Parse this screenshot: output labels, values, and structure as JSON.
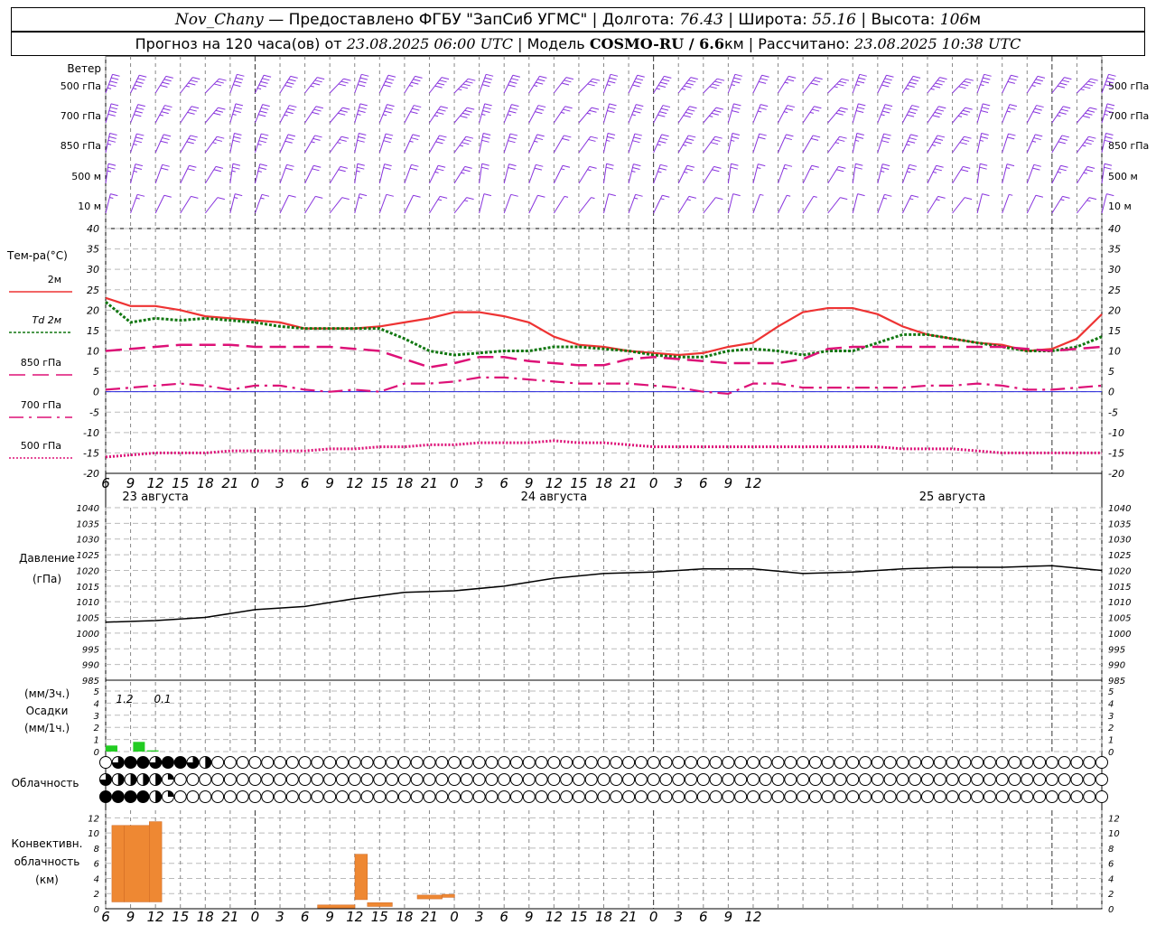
{
  "header": {
    "station": "Nov_Chany",
    "provider": "— Предоставлено ФГБУ \"ЗапСиб УГМС\"",
    "lon_label": "Долгота:",
    "lon_value": "76.43",
    "lat_label": "Широта:",
    "lat_value": "55.16",
    "alt_label": "Высота:",
    "alt_value": "106",
    "alt_unit": "м",
    "forecast_label": "Прогноз на 120 часа(ов) от",
    "forecast_start": "23.08.2025 06:00 UTC",
    "model_label": "Модель",
    "model_name": "COSMO-RU / 6.6",
    "model_unit": "км",
    "calc_label": "Рассчитано:",
    "calc_time": "23.08.2025 10:38 UTC"
  },
  "labels": {
    "wind": "Ветер",
    "wind_levels": [
      "500 гПа",
      "700 гПа",
      "850 гПа",
      "500 м",
      "10 м"
    ],
    "temp_title": "Тем-ра(°C)",
    "temp_legend": [
      "2м",
      "Td 2м",
      "850 гПа",
      "700 гПа",
      "500 гПа"
    ],
    "pressure_title": "Давление",
    "pressure_unit": "(гПа)",
    "precip_unit_3h": "(мм/3ч.)",
    "precip_title": "Осадки",
    "precip_unit_1h": "(мм/1ч.)",
    "precip_values": [
      "1.2",
      "0.1"
    ],
    "cloud_title": "Облачность",
    "conv_title_1": "Конвективн.",
    "conv_title_2": "облачность",
    "conv_unit": "(км)",
    "days": [
      "23 августа",
      "24 августа",
      "25 августа"
    ]
  },
  "colors": {
    "t2m": "#ee3333",
    "td2m": "#117711",
    "t850": "#dd1177",
    "t700": "#dd1177",
    "t500": "#dd1177",
    "wind": "#8833dd",
    "precip": "#22cc22",
    "conv": "#ee8833",
    "zero_line": "#2222dd"
  },
  "chart_data": [
    {
      "type": "line",
      "title": "Тем-ра(°C)",
      "x_unit": "hours from 23.08.2025 06:00 UTC",
      "x_tick_labels": [
        "6",
        "9",
        "12",
        "15",
        "18",
        "21",
        "0",
        "3",
        "6",
        "9",
        "12",
        "15",
        "18",
        "21",
        "0",
        "3",
        "6",
        "9",
        "12",
        "15",
        "18",
        "21",
        "0",
        "3",
        "6",
        "9",
        "12"
      ],
      "ylim": [
        -20,
        40
      ],
      "series": [
        {
          "name": "2м",
          "x": [
            0,
            3,
            6,
            9,
            12,
            15,
            18,
            21,
            24,
            27,
            30,
            33,
            36,
            39,
            42,
            45,
            48,
            51,
            54,
            57,
            60,
            63,
            66,
            69,
            72,
            75,
            78,
            81,
            84,
            87,
            90,
            93,
            96,
            99,
            102,
            105,
            108,
            111,
            114,
            117,
            120
          ],
          "values": [
            23,
            21,
            21,
            20,
            18.5,
            18,
            17.5,
            17,
            15.5,
            15.5,
            15.5,
            16,
            17,
            18,
            19.5,
            19.5,
            18.5,
            17,
            13.5,
            11.5,
            11,
            10,
            9.5,
            9,
            9.5,
            11,
            12,
            16,
            19.5,
            20.5,
            20.5,
            19,
            16,
            14,
            13,
            12,
            11.5,
            10,
            10.5,
            13,
            19
          ]
        },
        {
          "name": "Td 2м",
          "x": [
            0,
            3,
            6,
            9,
            12,
            15,
            18,
            21,
            24,
            27,
            30,
            33,
            36,
            39,
            42,
            45,
            48,
            51,
            54,
            57,
            60,
            63,
            66,
            69,
            72,
            75,
            78,
            81,
            84,
            87,
            90,
            93,
            96,
            99,
            102,
            105,
            108,
            111,
            114,
            117,
            120
          ],
          "values": [
            22,
            17,
            18,
            17.5,
            18,
            17.5,
            17,
            16,
            15.5,
            15.5,
            15.5,
            15.5,
            13,
            10,
            9,
            9.5,
            10,
            10,
            11,
            11,
            10.5,
            10,
            9,
            8.5,
            8.5,
            10,
            10.5,
            10,
            9,
            10,
            10,
            12,
            14,
            14,
            13,
            12,
            11,
            10,
            10,
            11,
            13.5
          ]
        },
        {
          "name": "850 гПа",
          "x": [
            0,
            3,
            6,
            9,
            12,
            15,
            18,
            21,
            24,
            27,
            30,
            33,
            36,
            39,
            42,
            45,
            48,
            51,
            54,
            57,
            60,
            63,
            66,
            69,
            72,
            75,
            78,
            81,
            84,
            87,
            90,
            93,
            96,
            99,
            102,
            105,
            108,
            111,
            114,
            117,
            120
          ],
          "values": [
            10,
            10.5,
            11,
            11.5,
            11.5,
            11.5,
            11,
            11,
            11,
            11,
            10.5,
            10,
            8,
            6,
            7,
            8.5,
            8.5,
            7.5,
            7,
            6.5,
            6.5,
            8,
            8.5,
            8,
            7.5,
            7,
            7,
            7,
            8,
            10.5,
            11,
            11,
            11,
            11,
            11,
            11,
            11,
            10.5,
            10,
            10.5,
            11
          ]
        },
        {
          "name": "700 гПа",
          "x": [
            0,
            3,
            6,
            9,
            12,
            15,
            18,
            21,
            24,
            27,
            30,
            33,
            36,
            39,
            42,
            45,
            48,
            51,
            54,
            57,
            60,
            63,
            66,
            69,
            72,
            75,
            78,
            81,
            84,
            87,
            90,
            93,
            96,
            99,
            102,
            105,
            108,
            111,
            114,
            117,
            120
          ],
          "values": [
            0.5,
            1,
            1.5,
            2,
            1.5,
            0.5,
            1.5,
            1.5,
            0.5,
            0,
            0.5,
            0,
            2,
            2,
            2.5,
            3.5,
            3.5,
            3,
            2.5,
            2,
            2,
            2,
            1.5,
            1,
            0,
            -0.5,
            2,
            2,
            1,
            1,
            1,
            1,
            1,
            1.5,
            1.5,
            2,
            1.5,
            0.5,
            0.5,
            1,
            1.5
          ]
        },
        {
          "name": "500 гПа",
          "x": [
            0,
            3,
            6,
            9,
            12,
            15,
            18,
            21,
            24,
            27,
            30,
            33,
            36,
            39,
            42,
            45,
            48,
            51,
            54,
            57,
            60,
            63,
            66,
            69,
            72,
            75,
            78,
            81,
            84,
            87,
            90,
            93,
            96,
            99,
            102,
            105,
            108,
            111,
            114,
            117,
            120
          ],
          "values": [
            -16,
            -15.5,
            -15,
            -15,
            -15,
            -14.5,
            -14.5,
            -14.5,
            -14.5,
            -14,
            -14,
            -13.5,
            -13.5,
            -13,
            -13,
            -12.5,
            -12.5,
            -12.5,
            -12,
            -12.5,
            -12.5,
            -13,
            -13.5,
            -13.5,
            -13.5,
            -13.5,
            -13.5,
            -13.5,
            -13.5,
            -13.5,
            -13.5,
            -13.5,
            -14,
            -14,
            -14,
            -14.5,
            -15,
            -15,
            -15,
            -15,
            -15
          ]
        }
      ]
    },
    {
      "type": "line",
      "title": "Давление",
      "ylabel": "(гПа)",
      "ylim": [
        985,
        1040
      ],
      "series": [
        {
          "x": [
            0,
            6,
            12,
            18,
            24,
            30,
            36,
            42,
            48,
            54,
            60,
            66,
            72,
            78,
            84,
            90,
            96,
            102,
            108,
            114,
            120
          ],
          "values": [
            1003.5,
            1004,
            1005,
            1007.5,
            1008.5,
            1011,
            1013,
            1013.5,
            1015,
            1017.5,
            1019,
            1019.5,
            1020.5,
            1020.5,
            1019,
            1019.5,
            1020.5,
            1021,
            1021,
            1021.5,
            1020
          ]
        }
      ]
    },
    {
      "type": "bar",
      "title": "Осадки",
      "ylabel": "(мм/1ч.)",
      "ylim": [
        0,
        5
      ],
      "x": [
        0,
        1,
        2,
        3,
        4
      ],
      "values": [
        0.5,
        0,
        0.8,
        0.1,
        0
      ],
      "annotations": [
        "1.2",
        "0.1"
      ]
    },
    {
      "type": "bar",
      "title": "Конвективн. облачность",
      "ylabel": "(км)",
      "ylim": [
        0,
        13
      ],
      "bars": [
        {
          "x0": 0.5,
          "x1": 1.5,
          "bottom": 0.9,
          "top": 11
        },
        {
          "x0": 1.5,
          "x1": 3.5,
          "bottom": 0.9,
          "top": 11
        },
        {
          "x0": 3.5,
          "x1": 4.5,
          "bottom": 0.9,
          "top": 11.5
        },
        {
          "x0": 17,
          "x1": 20,
          "bottom": 0.1,
          "top": 0.5
        },
        {
          "x0": 20,
          "x1": 21,
          "bottom": 1.2,
          "top": 7.2
        },
        {
          "x0": 21,
          "x1": 23,
          "bottom": 0.3,
          "top": 0.8
        },
        {
          "x0": 25,
          "x1": 27,
          "bottom": 1.3,
          "top": 1.8
        },
        {
          "x0": 27,
          "x1": 28,
          "bottom": 1.5,
          "top": 1.9
        },
        {
          "x0": 99,
          "x1": 100,
          "bottom": 1.3,
          "top": 1.7
        }
      ]
    }
  ],
  "cloud_rows": [
    "0344344320000000000000000000000000000000000000000000000000000000000000000000000000000000000000000000000000000000000000000000000",
    "3222210000000000000000000000000000000000000000000000000000000000000000000000000000000000000000000000000000000000000000000000000",
    "4444210000000000000000000000000000000000000000000000000000000000000000000000000000000000000000000000000000000000000000000000000"
  ]
}
